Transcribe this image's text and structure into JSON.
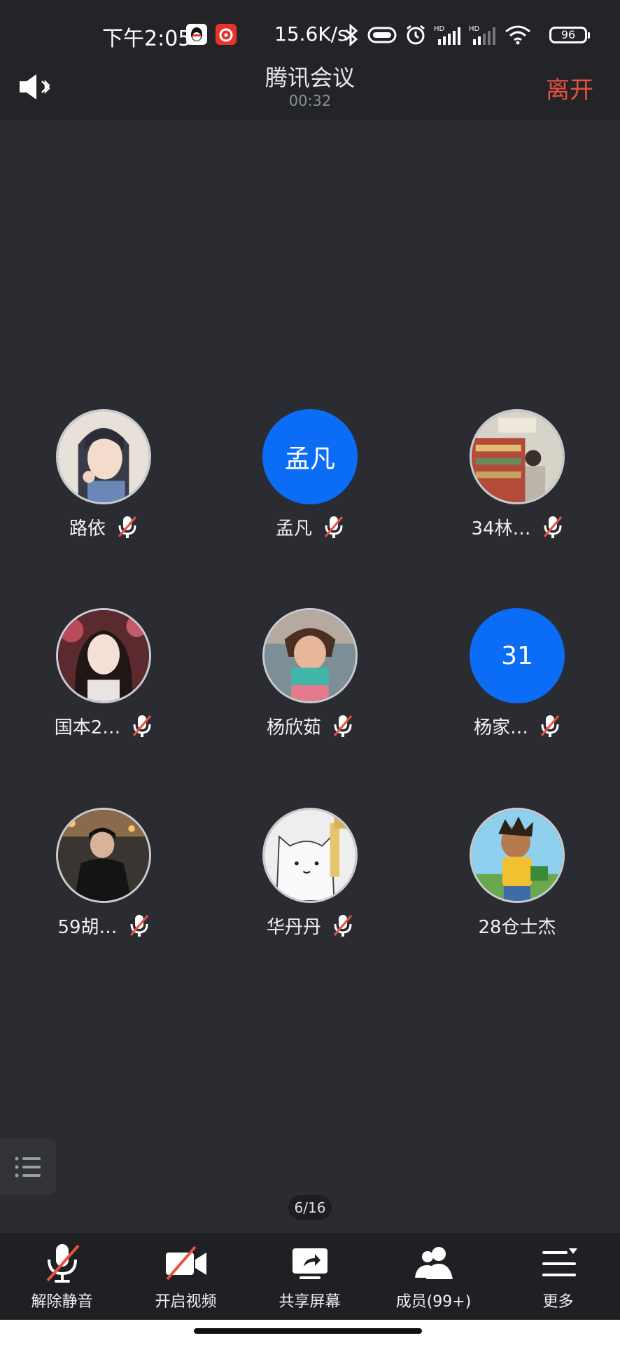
{
  "status_bar": {
    "time": "下午2:05",
    "network_speed": "15.6K/s",
    "battery": "96",
    "icons": [
      "qq-icon",
      "netease-music-icon",
      "bluetooth-icon",
      "vibrate-icon",
      "alarm-icon",
      "hd-signal-icon",
      "hd-signal-icon",
      "wifi-icon",
      "battery-icon"
    ]
  },
  "header": {
    "title": "腾讯会议",
    "timer": "00:32",
    "leave_label": "离开",
    "speaker_icon": "speaker-bluetooth-icon"
  },
  "participants": [
    {
      "name": "路依",
      "avatar_type": "image",
      "muted": true
    },
    {
      "name": "孟凡",
      "avatar_type": "text",
      "avatar_text": "孟凡",
      "muted": true
    },
    {
      "name": "34林…",
      "avatar_type": "image",
      "muted": true
    },
    {
      "name": "国本2…",
      "avatar_type": "image",
      "muted": true
    },
    {
      "name": "杨欣茹",
      "avatar_type": "image",
      "muted": true
    },
    {
      "name": "杨家…",
      "avatar_type": "text",
      "avatar_text": "31",
      "muted": true
    },
    {
      "name": "59胡…",
      "avatar_type": "image",
      "muted": true
    },
    {
      "name": "华丹丹",
      "avatar_type": "image",
      "muted": true
    },
    {
      "name": "28仓士杰",
      "avatar_type": "image",
      "muted": false
    }
  ],
  "pager": "6/16",
  "toolbar": {
    "items": [
      {
        "label": "解除静音",
        "icon": "mic-muted-icon"
      },
      {
        "label": "开启视频",
        "icon": "video-off-icon"
      },
      {
        "label": "共享屏幕",
        "icon": "share-screen-icon"
      },
      {
        "label": "成员(99+)",
        "icon": "members-icon"
      },
      {
        "label": "更多",
        "icon": "more-icon"
      }
    ]
  },
  "colors": {
    "background": "#2a2c31",
    "bar": "#232428",
    "accent_blue": "#0b6cf5",
    "leave_red": "#e8503f"
  }
}
